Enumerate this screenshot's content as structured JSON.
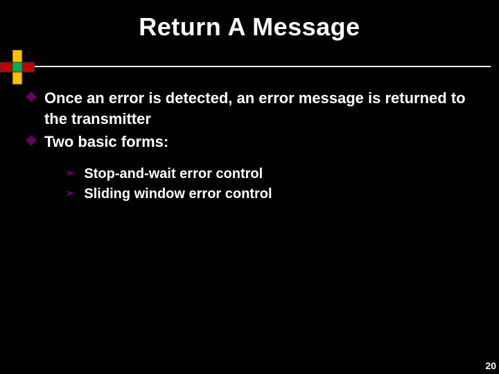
{
  "slide": {
    "title": "Return A Message",
    "bullets": [
      "Once an error is detected, an error message is returned to the transmitter",
      "Two basic forms:"
    ],
    "sub_bullets": [
      "Stop-and-wait error control",
      "Sliding window error control"
    ],
    "page_number": "20"
  }
}
